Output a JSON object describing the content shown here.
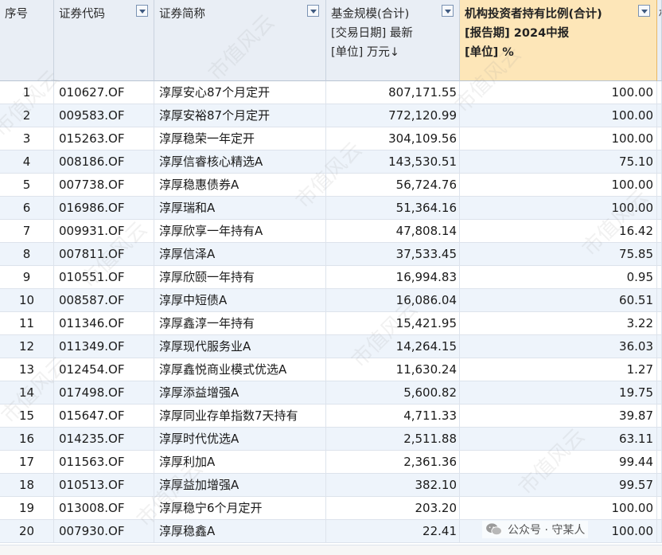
{
  "headers": {
    "idx": "序号",
    "code": "证券代码",
    "name": "证券简称",
    "scale_lines": [
      "基金规模(合计)",
      "[交易日期] 最新",
      "[单位] 万元↓"
    ],
    "ratio_lines": [
      "机构投资者持有比例(合计)",
      "[报告期] 2024中报",
      "[单位] %"
    ],
    "extra_partial": "机"
  },
  "rows": [
    {
      "idx": "1",
      "code": "010627.OF",
      "name": "淳厚安心87个月定开",
      "scale": "807,171.55",
      "ratio": "100.00"
    },
    {
      "idx": "2",
      "code": "009583.OF",
      "name": "淳厚安裕87个月定开",
      "scale": "772,120.99",
      "ratio": "100.00"
    },
    {
      "idx": "3",
      "code": "015263.OF",
      "name": "淳厚稳荣一年定开",
      "scale": "304,109.56",
      "ratio": "100.00"
    },
    {
      "idx": "4",
      "code": "008186.OF",
      "name": "淳厚信睿核心精选A",
      "scale": "143,530.51",
      "ratio": "75.10"
    },
    {
      "idx": "5",
      "code": "007738.OF",
      "name": "淳厚稳惠债券A",
      "scale": "56,724.76",
      "ratio": "100.00"
    },
    {
      "idx": "6",
      "code": "016986.OF",
      "name": "淳厚瑞和A",
      "scale": "51,364.16",
      "ratio": "100.00"
    },
    {
      "idx": "7",
      "code": "009931.OF",
      "name": "淳厚欣享一年持有A",
      "scale": "47,808.14",
      "ratio": "16.42"
    },
    {
      "idx": "8",
      "code": "007811.OF",
      "name": "淳厚信泽A",
      "scale": "37,533.45",
      "ratio": "75.85"
    },
    {
      "idx": "9",
      "code": "010551.OF",
      "name": "淳厚欣颐一年持有",
      "scale": "16,994.83",
      "ratio": "0.95"
    },
    {
      "idx": "10",
      "code": "008587.OF",
      "name": "淳厚中短债A",
      "scale": "16,086.04",
      "ratio": "60.51"
    },
    {
      "idx": "11",
      "code": "011346.OF",
      "name": "淳厚鑫淳一年持有",
      "scale": "15,421.95",
      "ratio": "3.22"
    },
    {
      "idx": "12",
      "code": "011349.OF",
      "name": "淳厚现代服务业A",
      "scale": "14,264.15",
      "ratio": "36.03"
    },
    {
      "idx": "13",
      "code": "012454.OF",
      "name": "淳厚鑫悦商业模式优选A",
      "scale": "11,630.24",
      "ratio": "1.27"
    },
    {
      "idx": "14",
      "code": "017498.OF",
      "name": "淳厚添益增强A",
      "scale": "5,600.82",
      "ratio": "19.75"
    },
    {
      "idx": "15",
      "code": "015647.OF",
      "name": "淳厚同业存单指数7天持有",
      "scale": "4,711.33",
      "ratio": "39.87"
    },
    {
      "idx": "16",
      "code": "014235.OF",
      "name": "淳厚时代优选A",
      "scale": "2,511.88",
      "ratio": "63.11"
    },
    {
      "idx": "17",
      "code": "011563.OF",
      "name": "淳厚利加A",
      "scale": "2,361.36",
      "ratio": "99.44"
    },
    {
      "idx": "18",
      "code": "010513.OF",
      "name": "淳厚益加增强A",
      "scale": "382.10",
      "ratio": "99.57"
    },
    {
      "idx": "19",
      "code": "013008.OF",
      "name": "淳厚稳宁6个月定开",
      "scale": "203.20",
      "ratio": "100.00"
    },
    {
      "idx": "20",
      "code": "007930.OF",
      "name": "淳厚稳鑫A",
      "scale": "22.41",
      "ratio": "100.00"
    }
  ],
  "watermark": "市值风云",
  "wechat_label": "公众号 · 守某人",
  "icons": {
    "dropdown": "dropdown-arrow-icon",
    "wechat": "wechat-icon"
  },
  "colors": {
    "header_bg": "#e9eef5",
    "active_header_bg": "#fde6b8",
    "alt_row_bg": "#eef4fb",
    "grid_line": "#dde3ec"
  }
}
